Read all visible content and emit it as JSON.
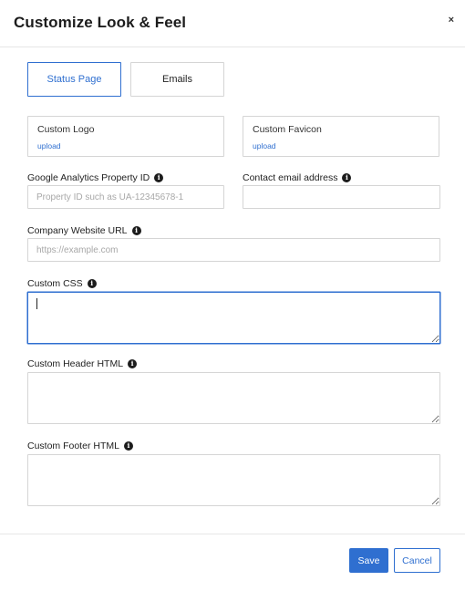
{
  "modal": {
    "title": "Customize Look & Feel",
    "close_glyph": "×"
  },
  "tabs": [
    {
      "label": "Status Page",
      "active": true
    },
    {
      "label": "Emails",
      "active": false
    }
  ],
  "uploads": {
    "logo": {
      "label": "Custom Logo",
      "link": "upload"
    },
    "favicon": {
      "label": "Custom Favicon",
      "link": "upload"
    }
  },
  "fields": {
    "ga": {
      "label": "Google Analytics Property ID",
      "placeholder": "Property ID such as UA-12345678-1",
      "value": "",
      "info_icon": "info-icon"
    },
    "contact_email": {
      "label": "Contact email address",
      "placeholder": "",
      "value": "",
      "info_icon": "info-icon"
    },
    "website_url": {
      "label": "Company Website URL",
      "placeholder": "https://example.com",
      "value": "",
      "info_icon": "info-icon"
    },
    "custom_css": {
      "label": "Custom CSS",
      "value": "",
      "info_icon": "info-icon"
    },
    "custom_header": {
      "label": "Custom Header HTML",
      "value": "",
      "info_icon": "info-icon"
    },
    "custom_footer": {
      "label": "Custom Footer HTML",
      "value": "",
      "info_icon": "info-icon"
    }
  },
  "info_glyph": "i",
  "buttons": {
    "save": "Save",
    "cancel": "Cancel"
  },
  "colors": {
    "accent": "#2f6fd0",
    "border": "#d5d5d5",
    "placeholder": "#a8a8a8"
  }
}
